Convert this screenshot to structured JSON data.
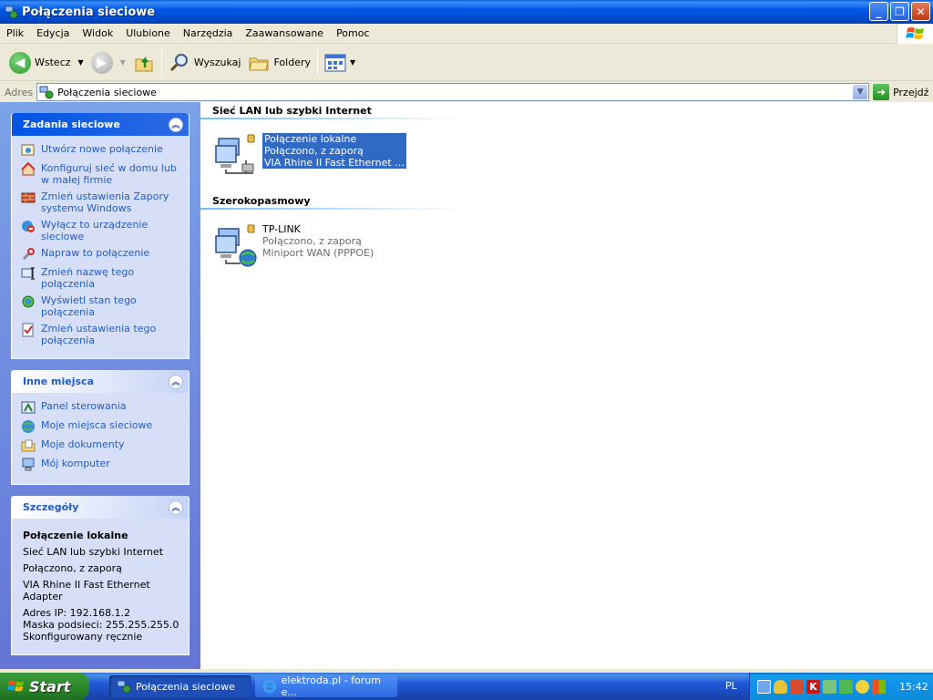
{
  "window": {
    "title": "Połączenia sieciowe",
    "minimize_label": "_",
    "maximize_label": "❐",
    "close_label": "✕"
  },
  "menu": [
    "Plik",
    "Edycja",
    "Widok",
    "Ulubione",
    "Narzędzia",
    "Zaawansowane",
    "Pomoc"
  ],
  "toolbar": {
    "back": "Wstecz",
    "search": "Wyszukaj",
    "folders": "Foldery"
  },
  "address": {
    "label": "Adres",
    "value": "Połączenia sieciowe",
    "go": "Przejdź"
  },
  "tasks_panel": {
    "title": "Zadania sieciowe",
    "items": [
      "Utwórz nowe połączenie",
      "Konfiguruj sieć w domu lub w małej firmie",
      "Zmień ustawienia Zapory systemu Windows",
      "Wyłącz to urządzenie sieciowe",
      "Napraw to połączenie",
      "Zmień nazwę tego połączenia",
      "Wyświetl stan tego połączenia",
      "Zmień ustawienia tego połączenia"
    ]
  },
  "places_panel": {
    "title": "Inne miejsca",
    "items": [
      "Panel sterowania",
      "Moje miejsca sieciowe",
      "Moje dokumenty",
      "Mój komputer"
    ]
  },
  "details_panel": {
    "title": "Szczegóły",
    "name": "Połączenie lokalne",
    "type": "Sieć LAN lub szybki Internet",
    "status": "Połączono, z zaporą",
    "adapter": "VIA Rhine II Fast Ethernet Adapter",
    "ip": "Adres IP: 192.168.1.2",
    "mask": "Maska podsieci: 255.255.255.0",
    "config": "Skonfigurowany ręcznie"
  },
  "groups": [
    {
      "title": "Sieć LAN lub szybki Internet",
      "connection": {
        "name": "Połączenie lokalne",
        "status": "Połączono, z zaporą",
        "device": "VIA Rhine II Fast Ethernet Ad..."
      }
    },
    {
      "title": "Szerokopasmowy",
      "connection": {
        "name": "TP-LINK",
        "status": "Połączono, z zaporą",
        "device": "Miniport WAN (PPPOE)"
      }
    }
  ],
  "taskbar": {
    "start": "Start",
    "tasks": [
      "Połączenia sieciowe",
      "elektroda.pl - forum e..."
    ],
    "lang": "PL",
    "clock": "15:42"
  },
  "colors": {
    "title_blue": "#0058E6",
    "panel_blue": "#6375D6",
    "link_blue": "#215DC6",
    "selection": "#316AC5",
    "start_green": "#2C8A2C"
  }
}
